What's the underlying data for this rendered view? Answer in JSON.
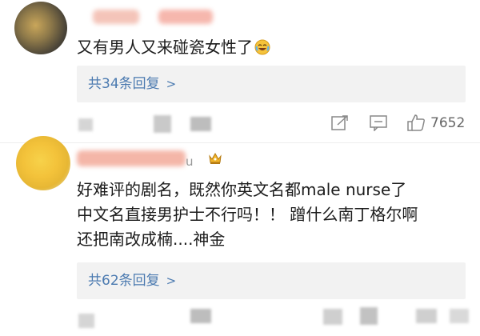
{
  "comments": [
    {
      "text": "又有男人又来碰瓷女性了",
      "reply_link": "共34条回复",
      "reply_chevron": ">",
      "likes": "7652"
    },
    {
      "name_suffix": "u",
      "text_line1": "好难评的剧名，既然你英文名都male nurse了",
      "text_line2": "中文名直接男护士不行吗！！ 蹭什么南丁格尔啊",
      "text_line3": "还把南改成楠....神金",
      "reply_link": "共62条回复",
      "reply_chevron": ">"
    }
  ],
  "icons": {
    "emoji": "laughing-crying-emoji-icon",
    "crown": "crown-badge-icon",
    "share": "share-icon",
    "comment": "comment-icon",
    "like": "thumbs-up-icon"
  },
  "colors": {
    "link": "#4b7ab0",
    "reply_bg": "#f2f2f2",
    "text": "#1c1c1c",
    "meta": "#666666"
  }
}
